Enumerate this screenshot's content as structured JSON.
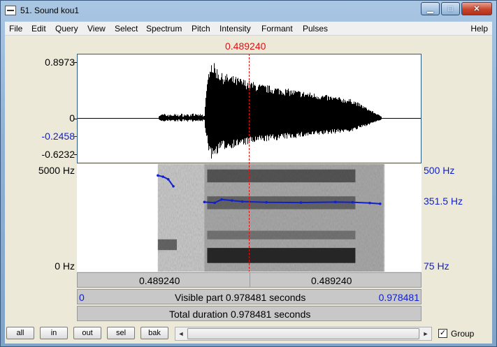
{
  "window": {
    "title": "51. Sound kou1",
    "minimize_glyph": "▁",
    "maximize_glyph": "□",
    "close_glyph": "✕"
  },
  "menu": {
    "items": [
      "File",
      "Edit",
      "Query",
      "View",
      "Select",
      "Spectrum",
      "Pitch",
      "Intensity",
      "Formant",
      "Pulses"
    ],
    "help": "Help"
  },
  "cursor": {
    "time_label": "0.489240",
    "time": 0.48924,
    "color": "#e01010"
  },
  "waveform": {
    "max_label": "0.8973",
    "zero_label": "0",
    "cursor_value_label": "-0.2458",
    "min_label": "-0.6232",
    "ymin": -0.6232,
    "ymax": 0.8973
  },
  "spectrogram": {
    "top_label": "5000 Hz",
    "bottom_label": "0 Hz",
    "fmax": 5000
  },
  "pitch": {
    "top_label": "500 Hz",
    "cursor_label": "351.5 Hz",
    "bottom_label": "75 Hz",
    "color": "#1020d0",
    "min_hz": 75,
    "max_hz": 500,
    "contour": [
      [
        0.235,
        455
      ],
      [
        0.25,
        450
      ],
      [
        0.265,
        440
      ],
      [
        0.28,
        412
      ],
      [
        0.37,
        350
      ],
      [
        0.4,
        347
      ],
      [
        0.42,
        360
      ],
      [
        0.45,
        356
      ],
      [
        0.48,
        352
      ],
      [
        0.55,
        349
      ],
      [
        0.65,
        348
      ],
      [
        0.75,
        350
      ],
      [
        0.8,
        349
      ],
      [
        0.85,
        346
      ],
      [
        0.88,
        343
      ]
    ]
  },
  "time_bar": {
    "left": "0.489240",
    "right": "0.489240"
  },
  "visible_bar": {
    "start": "0",
    "label": "Visible part 0.978481 seconds",
    "end": "0.978481"
  },
  "total_bar": {
    "label": "Total duration 0.978481 seconds"
  },
  "duration": 0.978481,
  "toolbar": {
    "buttons": [
      "all",
      "in",
      "out",
      "sel",
      "bak"
    ],
    "scroll_left": "◄",
    "scroll_right": "►",
    "group_label": "Group",
    "group_checked": "✓"
  }
}
